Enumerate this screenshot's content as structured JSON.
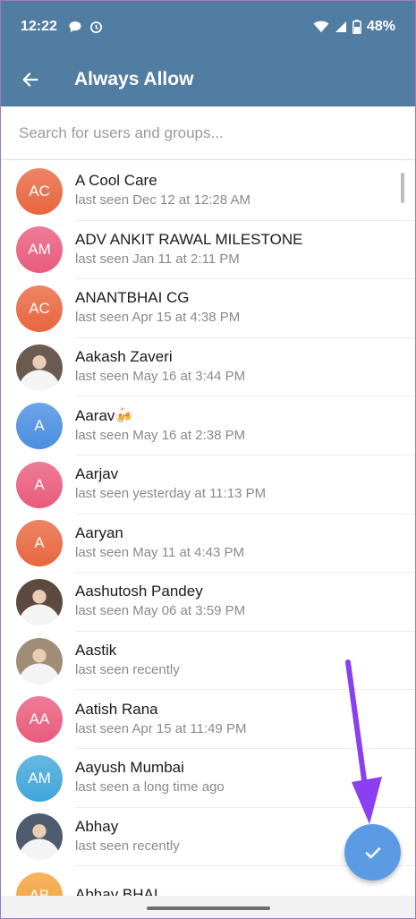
{
  "status_bar": {
    "time": "12:22",
    "battery": "48%"
  },
  "app_bar": {
    "title": "Always Allow"
  },
  "search": {
    "placeholder": "Search for users and groups..."
  },
  "contacts": [
    {
      "initials": "AC",
      "name": "A Cool Care",
      "status": "last seen Dec 12 at 12:28 AM",
      "color": "#e8663f",
      "photo": false
    },
    {
      "initials": "AM",
      "name": "ADV ANKIT RAWAL MILESTONE",
      "status": "last seen Jan 11 at 2:11 PM",
      "color": "#e95b7c",
      "photo": false
    },
    {
      "initials": "AC",
      "name": "ANANTBHAI CG",
      "status": "last seen Apr 15 at 4:38 PM",
      "color": "#e8663f",
      "photo": false
    },
    {
      "initials": "",
      "name": "Aakash Zaveri",
      "status": "last seen May 16 at 3:44 PM",
      "color": "#6b5a50",
      "photo": true
    },
    {
      "initials": "A",
      "name": "Aarav🍻",
      "status": "last seen May 16 at 2:38 PM",
      "color": "#4a8ee0",
      "photo": false
    },
    {
      "initials": "A",
      "name": "Aarjav",
      "status": "last seen yesterday at 11:13 PM",
      "color": "#e95b7c",
      "photo": false
    },
    {
      "initials": "A",
      "name": "Aaryan",
      "status": "last seen May 11 at 4:43 PM",
      "color": "#e8663f",
      "photo": false
    },
    {
      "initials": "",
      "name": "Aashutosh Pandey",
      "status": "last seen May 06 at 3:59 PM",
      "color": "#5d4a3e",
      "photo": true
    },
    {
      "initials": "",
      "name": "Aastik",
      "status": "last seen recently",
      "color": "#a08d78",
      "photo": true
    },
    {
      "initials": "AA",
      "name": "Aatish Rana",
      "status": "last seen Apr 15 at 11:49 PM",
      "color": "#e95b7c",
      "photo": false
    },
    {
      "initials": "AM",
      "name": "Aayush Mumbai",
      "status": "last seen a long time ago",
      "color": "#40a6d8",
      "photo": false
    },
    {
      "initials": "",
      "name": "Abhay",
      "status": "last seen recently",
      "color": "#4d5c6e",
      "photo": true
    },
    {
      "initials": "AB",
      "name": "Abhay BHAI",
      "status": "",
      "color": "#f2a23a",
      "photo": false
    }
  ],
  "icons": {
    "back": "arrow-left-icon",
    "fab": "check-icon",
    "status": [
      "chat-bubble-icon",
      "alarm-icon",
      "wifi-icon",
      "signal-icon",
      "battery-icon"
    ]
  },
  "colors": {
    "app_bar": "#527da3",
    "fab": "#5b9be3",
    "annotation_arrow": "#8a3ff0"
  }
}
